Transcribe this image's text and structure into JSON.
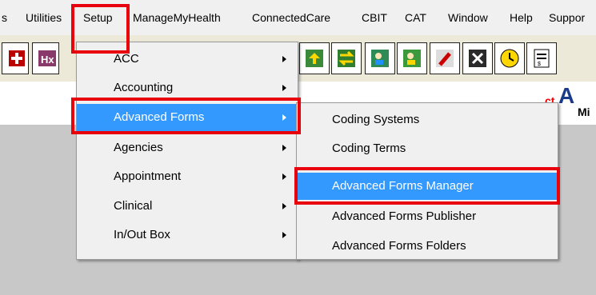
{
  "menubar": {
    "items": [
      {
        "label": "s"
      },
      {
        "label": "Utilities"
      },
      {
        "label": "Setup"
      },
      {
        "label": "ManageMyHealth"
      },
      {
        "label": "ConnectedCare"
      },
      {
        "label": "CBIT"
      },
      {
        "label": "CAT"
      },
      {
        "label": "Window"
      },
      {
        "label": "Help"
      },
      {
        "label": "Suppor"
      }
    ]
  },
  "background": {
    "title_fragment": "A",
    "subtitle_fragment": "Mi",
    "red_fragment": "ct"
  },
  "setup_menu": {
    "items": [
      {
        "label": "ACC",
        "submenu": true
      },
      {
        "label": "Accounting",
        "submenu": true
      },
      {
        "label": "Advanced Forms",
        "submenu": true
      },
      {
        "label": "Agencies",
        "submenu": true
      },
      {
        "label": "Appointment",
        "submenu": true
      },
      {
        "label": "Clinical",
        "submenu": true
      },
      {
        "label": "In/Out Box",
        "submenu": true
      }
    ]
  },
  "advanced_forms_submenu": {
    "items": [
      {
        "label": "Coding Systems"
      },
      {
        "label": "Coding Terms"
      },
      {
        "label": "Advanced Forms Manager"
      },
      {
        "label": "Advanced Forms Publisher"
      },
      {
        "label": "Advanced Forms Folders"
      }
    ]
  },
  "colors": {
    "highlight": "#3399ff",
    "annotation": "#e8000d"
  }
}
